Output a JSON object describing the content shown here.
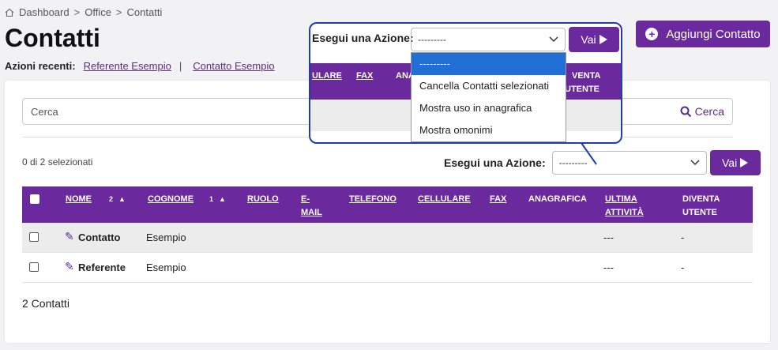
{
  "breadcrumb": {
    "items": [
      "Dashboard",
      "Office",
      "Contatti"
    ],
    "sep": ">"
  },
  "page_title": "Contatti",
  "recent": {
    "label": "Azioni recenti:",
    "links": [
      "Referente Esempio",
      "Contatto Esempio"
    ],
    "sep": "|"
  },
  "add_button": "Aggiungi Contatto",
  "search": {
    "placeholder": "Cerca",
    "button": "Cerca"
  },
  "selection": {
    "count_text": "0 di 2 selezionati"
  },
  "action": {
    "label": "Esegui una Azione:",
    "selected": "---------",
    "go": "Vai",
    "options": [
      "---------",
      "Cancella Contatti selezionati",
      "Mostra uso in anagrafica",
      "Mostra omonimi"
    ]
  },
  "table": {
    "headers": {
      "nome": "NOME",
      "nome_sort": "2",
      "cognome": "COGNOME",
      "cognome_sort": "1",
      "ruolo": "RUOLO",
      "email_a": "E-",
      "email_b": "MAIL",
      "telefono": "TELEFONO",
      "cellulare": "CELLULARE",
      "fax": "FAX",
      "anagrafica": "ANAGRAFICA",
      "ultima_a": "ULTIMA",
      "ultima_b": "ATTIVITÀ",
      "diventa_a": "DIVENTA",
      "diventa_b": "UTENTE"
    },
    "rows": [
      {
        "nome": "Contatto",
        "cognome": "Esempio",
        "ultima": "---",
        "diventa": "-"
      },
      {
        "nome": "Referente",
        "cognome": "Esempio",
        "ultima": "---",
        "diventa": "-"
      }
    ]
  },
  "callout_headers": {
    "cellulare_frag": "ULARE",
    "fax": "FAX",
    "anag_frag": "ANA",
    "diventa_frag": "VENTA",
    "utente_frag": "UTENTE"
  },
  "footer": {
    "count": "2 Contatti"
  },
  "colors": {
    "primary": "#6a2a9e",
    "callout_border": "#1f3fb0",
    "option_highlight": "#1f6fd4"
  }
}
